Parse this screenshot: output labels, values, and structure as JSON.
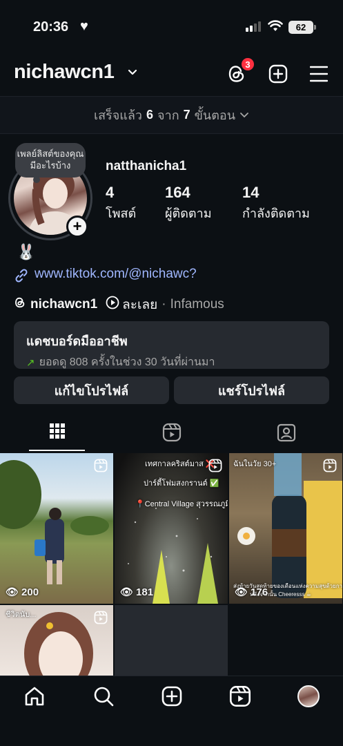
{
  "status_bar": {
    "time": "20:36",
    "battery": "62"
  },
  "header": {
    "username": "nichawcn1",
    "notification_count": "3"
  },
  "steps": {
    "prefix": "เสร็จแล้ว",
    "done": "6",
    "middle": "จาก",
    "total": "7",
    "suffix": "ขั้นตอน"
  },
  "profile": {
    "note": "เพลย์ลิสต์ของคุณมีอะไรบ้าง",
    "display_name": "natthanicha1",
    "stats": [
      {
        "value": "4",
        "label": "โพสต์"
      },
      {
        "value": "164",
        "label": "ผู้ติดตาม"
      },
      {
        "value": "14",
        "label": "กำลังติดตาม"
      }
    ],
    "bio_emoji": "🐰",
    "link": "www.tiktok.com/@nichawc?",
    "threads_name": "nichawcn1",
    "music_title": "ละเลย",
    "music_artist": "Infamous"
  },
  "dashboard": {
    "title": "แดชบอร์ดมืออาชีพ",
    "subtitle": "ยอดดู 808 ครั้งในช่วง 30 วันที่ผ่านมา"
  },
  "buttons": {
    "edit": "แก้ไขโปรไฟล์",
    "share": "แชร์โปรไฟล์"
  },
  "tabs": [
    "grid-icon",
    "reels-icon",
    "tagged-icon"
  ],
  "posts": [
    {
      "views": "200",
      "captions": []
    },
    {
      "views": "181",
      "captions": [
        "เทศกาลคริสต์มาส ❌",
        "ปาร์ตี้โฟมสงกรานต์ ✅",
        "📍Central Village สุวรรณภูมิ"
      ]
    },
    {
      "views": "176",
      "captions": [
        "ฉันในวัย 30+",
        "ส่งท้ายวันสุดท้ายของเดือนแห่งความสุขด้วยกาแฟเย็น",
        "หลังจากนั้น Cheeresss ☕"
      ]
    },
    {
      "views": "",
      "captions": [
        "ชีวิตนับ..."
      ]
    }
  ],
  "nav": [
    "home-icon",
    "search-icon",
    "create-icon",
    "reels-icon",
    "profile-avatar"
  ]
}
